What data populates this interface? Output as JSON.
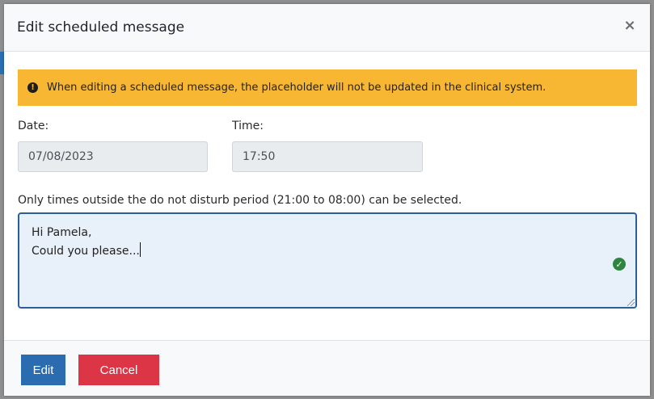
{
  "modal": {
    "title": "Edit scheduled message",
    "close_label": "×"
  },
  "alert": {
    "icon": "exclamation-circle-icon",
    "icon_glyph": "!",
    "text": "When editing a scheduled message, the placeholder will not be updated in the clinical system."
  },
  "form": {
    "date_label": "Date:",
    "date_value": "07/08/2023",
    "time_label": "Time:",
    "time_value": "17:50",
    "hint": "Only times outside the do not disturb period (21:00 to 08:00) can be selected.",
    "message_line1": "Hi Pamela,",
    "message_line2": "Could you please...",
    "valid_icon": "check-circle-icon",
    "valid_glyph": "✓"
  },
  "footer": {
    "edit_label": "Edit",
    "cancel_label": "Cancel"
  },
  "colors": {
    "alert_bg": "#f7b733",
    "edit_button": "#2b6cb0",
    "cancel_button": "#dc3545",
    "valid_green": "#2e8540",
    "textarea_border": "#2a5f9c"
  }
}
